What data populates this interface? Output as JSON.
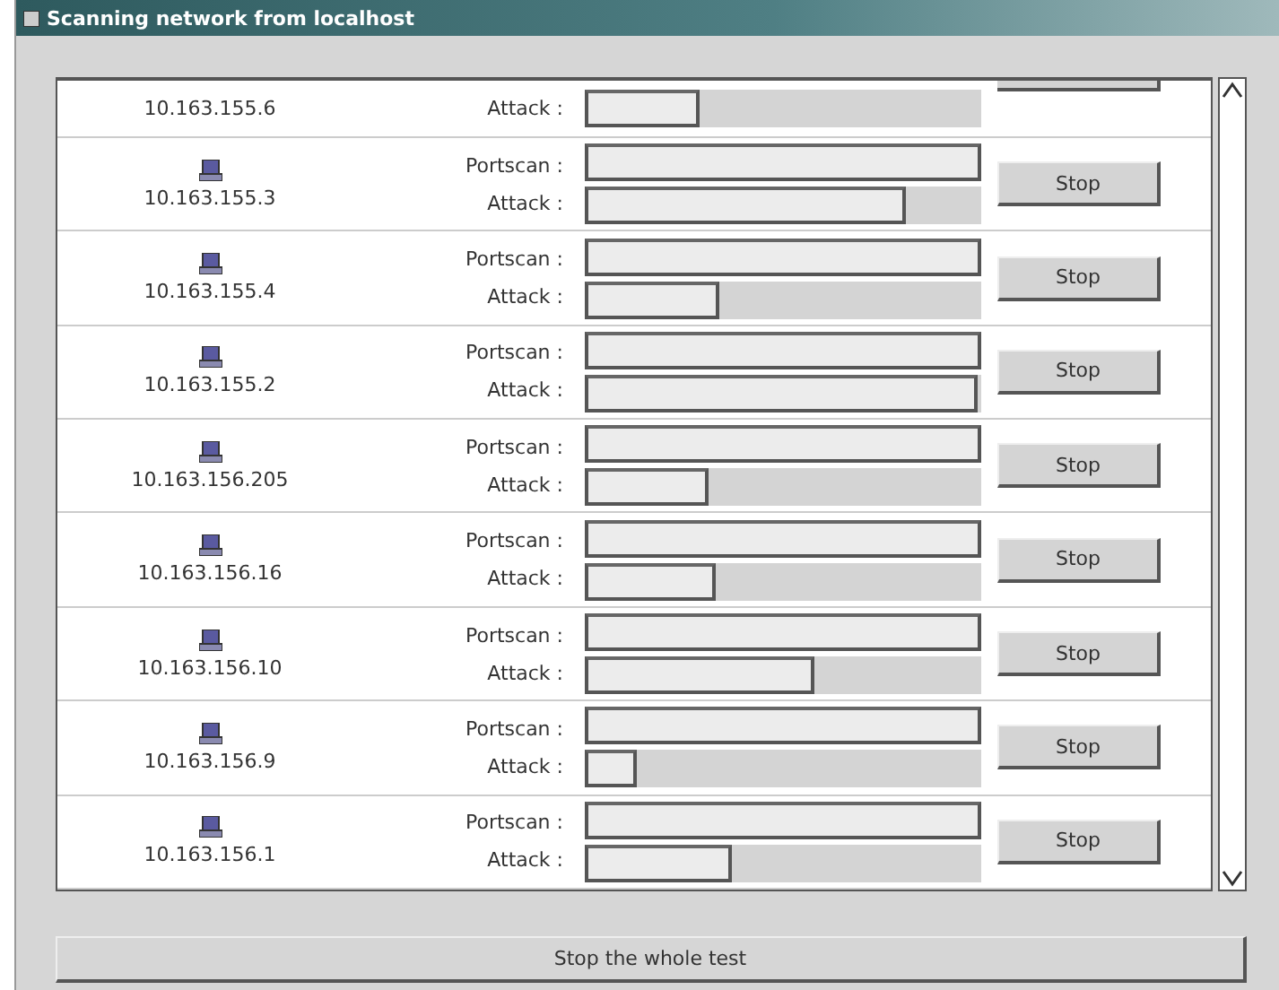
{
  "window": {
    "title": "Scanning network from localhost"
  },
  "hosts": [
    {
      "kind": "clipped",
      "ip": "10.163.155.6",
      "attack": {
        "label": "Attack :",
        "level": 0.29
      }
    },
    {
      "kind": "full",
      "ip": "10.163.155.3",
      "portscan": {
        "label": "Portscan :",
        "level": 1
      },
      "attack": {
        "label": "Attack :",
        "level": 0.81
      },
      "button": "Stop"
    },
    {
      "kind": "full",
      "ip": "10.163.155.4",
      "portscan": {
        "label": "Portscan :",
        "level": 1
      },
      "attack": {
        "label": "Attack :",
        "level": 0.34
      },
      "button": "Stop"
    },
    {
      "kind": "full",
      "ip": "10.163.155.2",
      "portscan": {
        "label": "Portscan :",
        "level": 1
      },
      "attack": {
        "label": "Attack :",
        "level": 0.99
      },
      "button": "Stop"
    },
    {
      "kind": "full",
      "ip": "10.163.156.205",
      "portscan": {
        "label": "Portscan :",
        "level": 1
      },
      "attack": {
        "label": "Attack :",
        "level": 0.31
      },
      "button": "Stop"
    },
    {
      "kind": "full",
      "ip": "10.163.156.16",
      "portscan": {
        "label": "Portscan :",
        "level": 1
      },
      "attack": {
        "label": "Attack :",
        "level": 0.33
      },
      "button": "Stop"
    },
    {
      "kind": "full",
      "ip": "10.163.156.10",
      "portscan": {
        "label": "Portscan :",
        "level": 1
      },
      "attack": {
        "label": "Attack :",
        "level": 0.58
      },
      "button": "Stop"
    },
    {
      "kind": "full",
      "ip": "10.163.156.9",
      "portscan": {
        "label": "Portscan :",
        "level": 1
      },
      "attack": {
        "label": "Attack :",
        "level": 0.13
      },
      "button": "Stop"
    },
    {
      "kind": "full",
      "ip": "10.163.156.1",
      "portscan": {
        "label": "Portscan :",
        "level": 1
      },
      "attack": {
        "label": "Attack :",
        "level": 0.37
      },
      "button": "Stop"
    }
  ],
  "stop_all_button": "Stop the whole test"
}
